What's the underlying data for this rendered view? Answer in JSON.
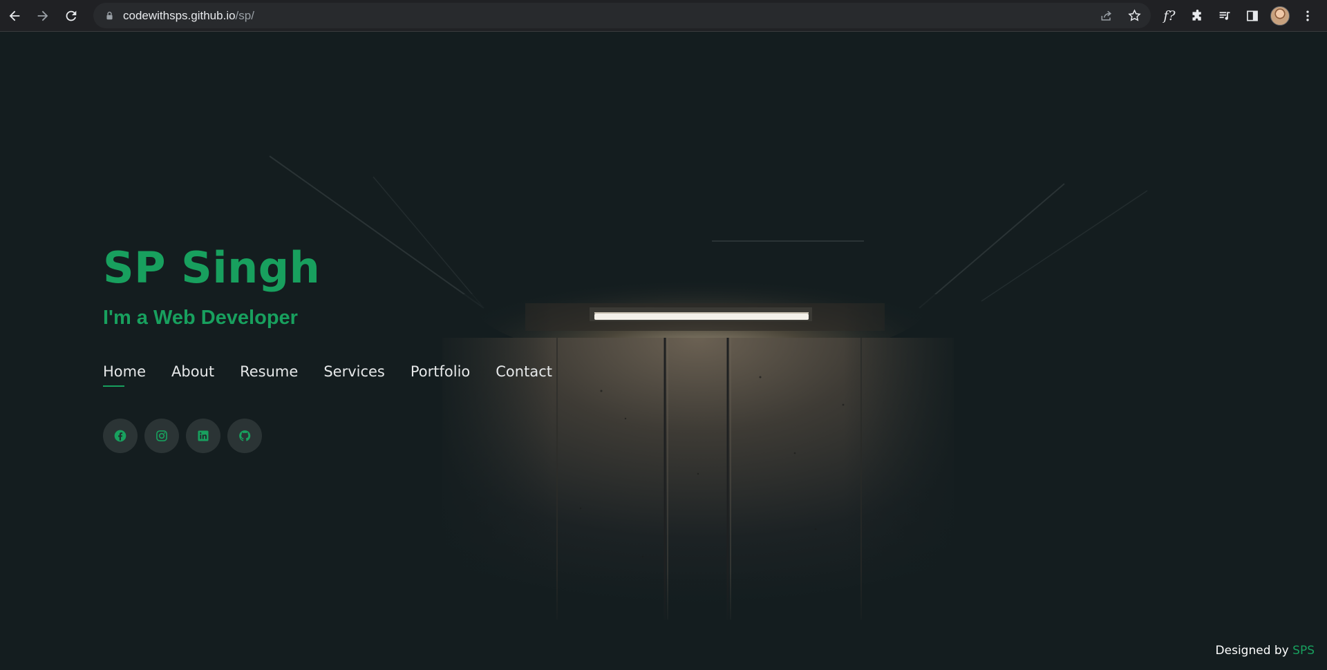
{
  "browser": {
    "url_host": "codewithsps.github.io",
    "url_path": "/sp/",
    "icons": [
      "back-icon",
      "forward-icon",
      "reload-icon",
      "lock-icon",
      "share-icon",
      "star-icon",
      "font-finder-icon",
      "extensions-icon",
      "media-control-icon",
      "side-panel-icon",
      "profile-avatar",
      "menu-icon"
    ],
    "font_finder_label": "f?"
  },
  "hero": {
    "name": "SP Singh",
    "tagline": "I'm a Web Developer"
  },
  "nav": {
    "items": [
      {
        "label": "Home",
        "active": true
      },
      {
        "label": "About"
      },
      {
        "label": "Resume"
      },
      {
        "label": "Services"
      },
      {
        "label": "Portfolio"
      },
      {
        "label": "Contact"
      }
    ]
  },
  "socials": [
    "facebook-icon",
    "instagram-icon",
    "linkedin-icon",
    "github-icon"
  ],
  "footer": {
    "prefix": "Designed by",
    "brand": "SPS"
  },
  "colors": {
    "accent": "#18a05e",
    "background": "#141d1f",
    "chrome": "#202124"
  }
}
